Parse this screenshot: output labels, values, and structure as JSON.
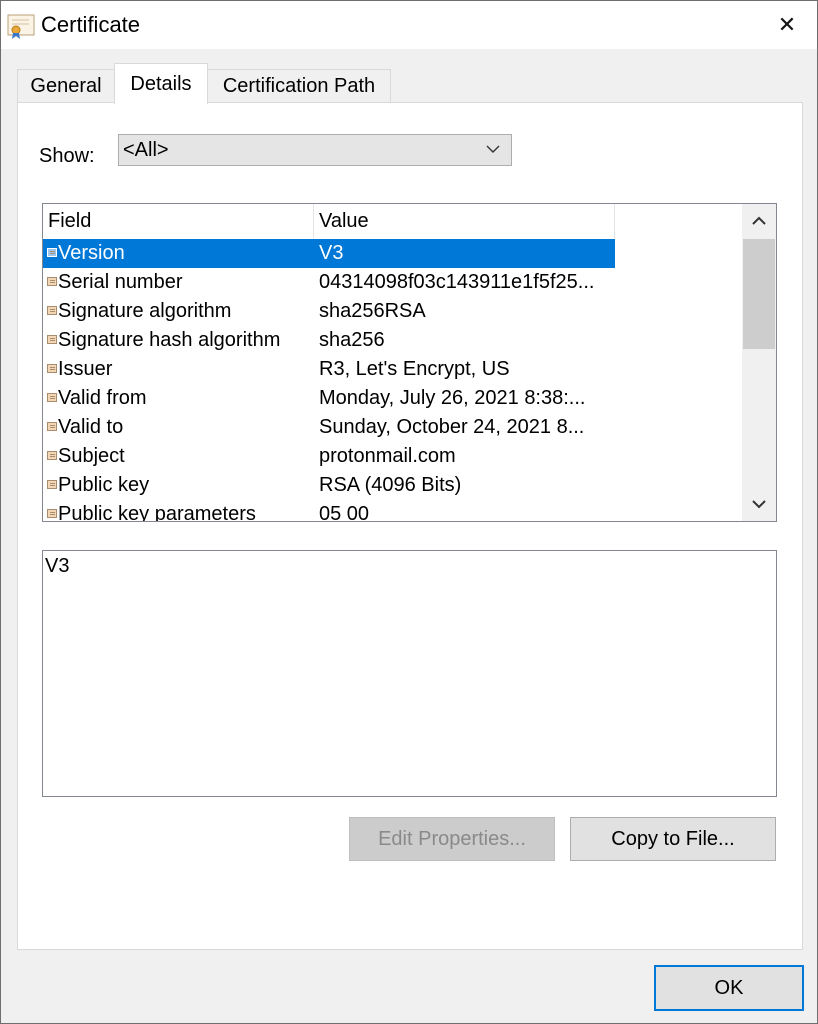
{
  "window": {
    "title": "Certificate",
    "close_glyph": "✕"
  },
  "tabs": [
    {
      "label": "General",
      "active": false
    },
    {
      "label": "Details",
      "active": true
    },
    {
      "label": "Certification Path",
      "active": false
    }
  ],
  "show": {
    "label": "Show:",
    "selected": "<All>"
  },
  "list": {
    "columns": [
      "Field",
      "Value"
    ],
    "rows": [
      {
        "field": "Version",
        "value": "V3",
        "selected": true
      },
      {
        "field": "Serial number",
        "value": "04314098f03c143911e1f5f25..."
      },
      {
        "field": "Signature algorithm",
        "value": "sha256RSA"
      },
      {
        "field": "Signature hash algorithm",
        "value": "sha256"
      },
      {
        "field": "Issuer",
        "value": "R3, Let's Encrypt, US"
      },
      {
        "field": "Valid from",
        "value": "Monday, July 26, 2021 8:38:..."
      },
      {
        "field": "Valid to",
        "value": "Sunday, October 24, 2021 8..."
      },
      {
        "field": "Subject",
        "value": "protonmail.com"
      },
      {
        "field": "Public key",
        "value": "RSA (4096 Bits)"
      },
      {
        "field": "Public key parameters",
        "value": "05 00"
      }
    ]
  },
  "detail": {
    "text": "V3"
  },
  "buttons": {
    "edit_properties": "Edit Properties...",
    "copy_to_file": "Copy to File...",
    "ok": "OK"
  },
  "colors": {
    "selection": "#0078d7",
    "default_button_border": "#0078d7"
  }
}
